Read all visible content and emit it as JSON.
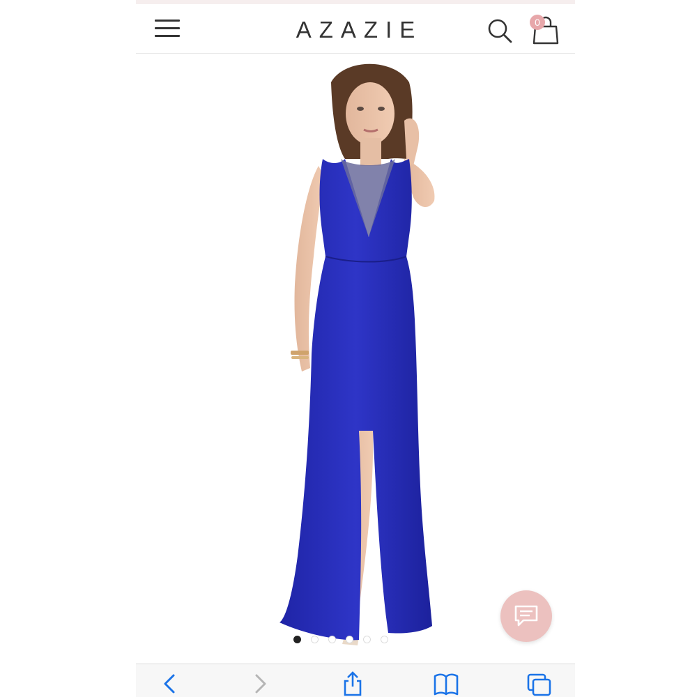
{
  "header": {
    "logo_text": "AZAZIE",
    "cart_count": "0",
    "icons": [
      "menu-icon",
      "search-icon",
      "shopping-bag-icon"
    ]
  },
  "product": {
    "dress_color": "#2a2fb8",
    "gallery_dots": 6,
    "active_dot": 1
  },
  "chat": {
    "icon": "chat-bubble-icon",
    "color": "#ecc1bf"
  },
  "browser_toolbar": {
    "icons": [
      "back-icon",
      "forward-icon",
      "share-icon",
      "bookmarks-icon",
      "tabs-icon"
    ],
    "accent": "#1a73e8"
  }
}
